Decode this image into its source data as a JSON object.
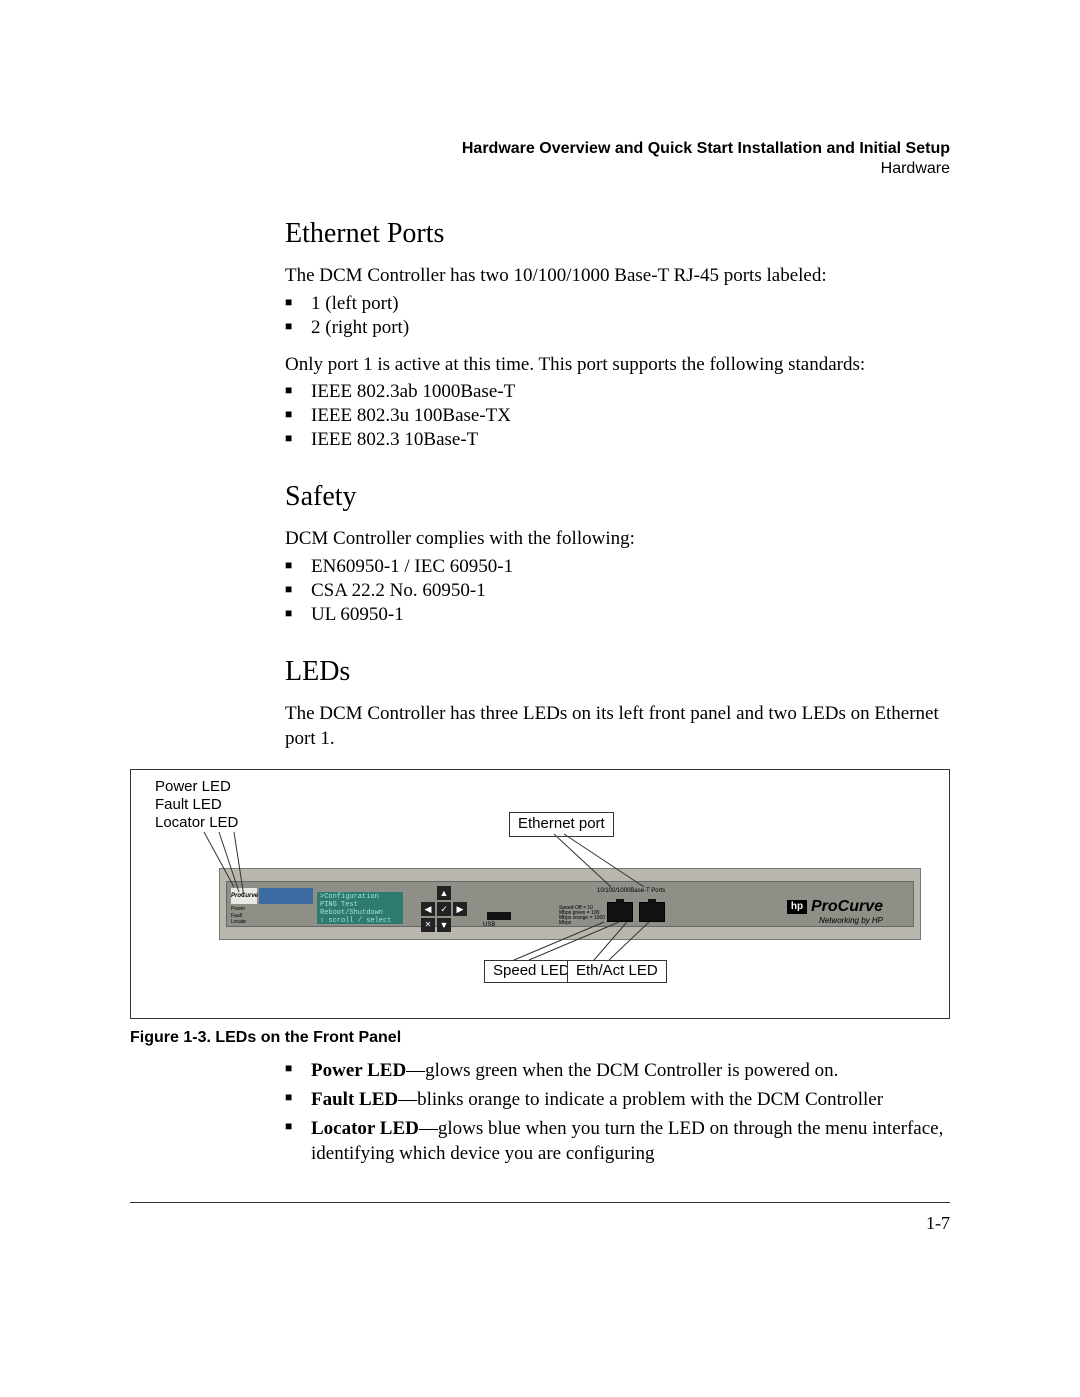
{
  "header": {
    "title": "Hardware Overview and Quick Start Installation and Initial Setup",
    "subtitle": "Hardware"
  },
  "sections": {
    "ethernet": {
      "heading": "Ethernet Ports",
      "intro": "The DCM Controller has two 10/100/1000 Base-T RJ-45 ports labeled:",
      "ports": [
        "1 (left port)",
        "2 (right port)"
      ],
      "note": "Only port 1 is active at this time. This port supports the following standards:",
      "standards": [
        "IEEE 802.3ab 1000Base-T",
        "IEEE 802.3u 100Base-TX",
        "IEEE 802.3 10Base-T"
      ]
    },
    "safety": {
      "heading": "Safety",
      "intro": "DCM Controller complies with the following:",
      "items": [
        "EN60950-1 / IEC 60950-1",
        "CSA 22.2 No. 60950-1",
        "UL 60950-1"
      ]
    },
    "leds": {
      "heading": "LEDs",
      "intro": "The DCM Controller has three LEDs on its left front panel and two LEDs on Ethernet port 1.",
      "caption": "Figure 1-3.   LEDs on the Front Panel",
      "callouts": {
        "top_left_1": "Power LED",
        "top_left_2": "Fault LED",
        "top_left_3": "Locator LED",
        "top_mid": "Ethernet port",
        "bottom_speed": "Speed LED",
        "bottom_ethact": "Eth/Act LED"
      },
      "device": {
        "brand": "ProCurve",
        "brand_sub": "Networking by HP",
        "hp": "hp",
        "pc_badge": "ProCurve",
        "side_power": "Power",
        "side_fault": "Fault",
        "side_locate": "Locate",
        "lcd_l1": ">Configuration",
        "lcd_l2": " PING Test",
        "lcd_l3": " Reboot/Shutdown",
        "lcd_l4": "↕ scroll / select",
        "usb_label": "USB",
        "ports_label": "10/100/1000Base-T Ports",
        "speed_tiny": "Speed-Off = 10 Mbps  green = 100 Mbps  orange = 1000 Mbps"
      },
      "descriptions": {
        "power_b": "Power LED",
        "power_t": "—glows green when the DCM Controller is powered on.",
        "fault_b": "Fault LED",
        "fault_t": "—blinks orange to indicate a problem with the DCM Controller",
        "locator_b": "Locator LED",
        "locator_t": "—glows blue when you turn the LED on through the menu interface, identifying which device you are configuring"
      }
    }
  },
  "page_number": "1-7"
}
